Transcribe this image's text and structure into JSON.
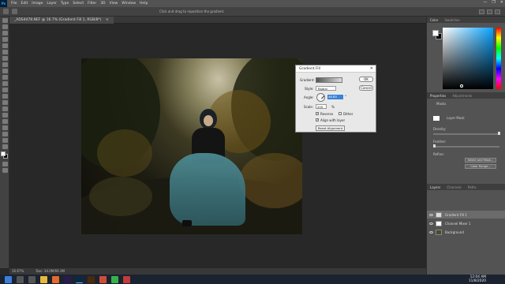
{
  "menubar": {
    "logo": "Ps",
    "items": [
      "File",
      "Edit",
      "Image",
      "Layer",
      "Type",
      "Select",
      "Filter",
      "3D",
      "View",
      "Window",
      "Help"
    ],
    "controls": [
      "—",
      "❐",
      "✕"
    ]
  },
  "options": {
    "hint": "Click and drag to reposition the gradient."
  },
  "document": {
    "tab_title": "_ADS4478.NEF @ 16.7% (Gradient Fill 1, RGB/8*)",
    "tab_close": "×"
  },
  "status": {
    "zoom": "16.67%",
    "doc": "Doc: 34.0M/69.3M"
  },
  "color_panel": {
    "tabs": [
      "Color",
      "Swatches"
    ],
    "fg_color": "#ffffff",
    "bg_color": "#000000"
  },
  "properties_panel": {
    "tabs": [
      "Properties",
      "Adjustments"
    ],
    "masks_label": "Masks",
    "layer_mask_label": "Layer Mask",
    "density_label": "Density:",
    "feather_label": "Feather:",
    "refine_label": "Refine:",
    "select_mask_button": "Select and Mask...",
    "color_range_button": "Color Range..."
  },
  "layers_panel": {
    "tabs": [
      "Layers",
      "Channels",
      "Paths"
    ],
    "layers": [
      {
        "name": "Gradient Fill 1",
        "selected": true,
        "thumb": "#dcdcdc"
      },
      {
        "name": "Channel Mixer 1",
        "selected": false,
        "thumb": "#ffffff"
      },
      {
        "name": "Background",
        "selected": false,
        "thumb": "#4a4a2e"
      }
    ]
  },
  "dialog": {
    "title": "Gradient Fill",
    "gradient_label": "Gradient:",
    "style_label": "Style:",
    "style_value": "Radial",
    "angle_label": "Angle:",
    "angle_value": "46.85",
    "angle_unit": "°",
    "scale_label": "Scale:",
    "scale_value": "200",
    "scale_unit": "%",
    "reverse_label": "Reverse",
    "dither_label": "Dither",
    "align_label": "Align with layer",
    "reset_button": "Reset Alignment",
    "ok_button": "OK",
    "cancel_button": "Cancel",
    "reverse_checked": true,
    "dither_checked": false,
    "align_checked": true
  },
  "taskbar": {
    "time": "12:04 AM",
    "date": "11/8/2020"
  }
}
